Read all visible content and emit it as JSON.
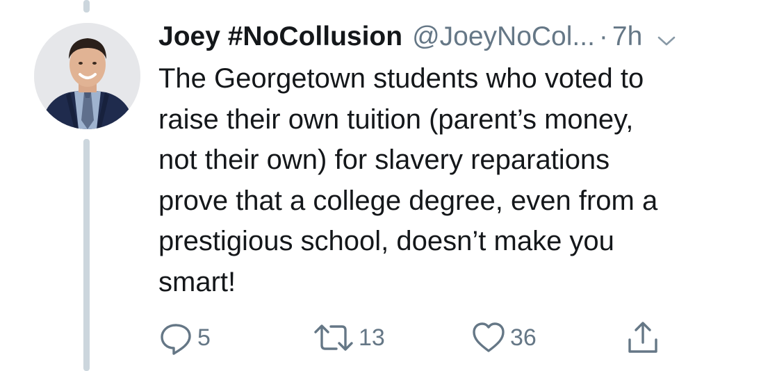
{
  "tweet": {
    "display_name": "Joey #NoCollusion",
    "handle": "@JoeyNoCol...",
    "separator": "·",
    "time": "7h",
    "text": "The Georgetown students who voted to\nraise their own tuition (parent’s money,\nnot their own) for slavery reparations\nprove that a college degree, even from a\nprestigious school, doesn’t make you\nsmart!"
  },
  "actions": {
    "reply_count": "5",
    "retweet_count": "13",
    "like_count": "36"
  },
  "colors": {
    "text": "#14171a",
    "secondary": "#657786",
    "thread_line": "#ccd6dd",
    "background": "#ffffff"
  },
  "icons": {
    "reply": "reply-icon",
    "retweet": "retweet-icon",
    "like": "heart-icon",
    "share": "share-icon",
    "menu": "chevron-down-icon"
  }
}
